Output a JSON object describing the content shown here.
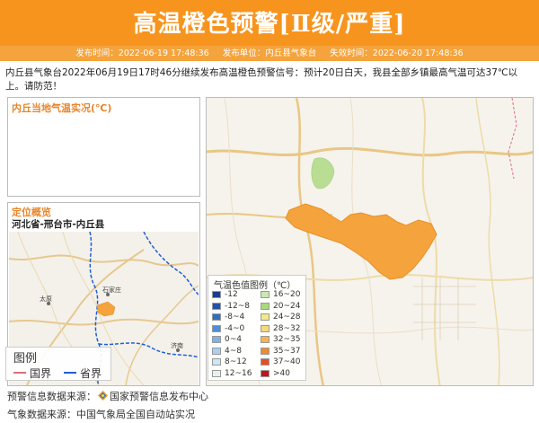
{
  "header": {
    "title": "高温橙色预警[Ⅱ级/严重]"
  },
  "meta": {
    "publish_time": "发布时间：2022-06-19 17:48:36",
    "publisher": "发布单位：内丘县气象台",
    "expire_time": "失效时间：2022-06-20 17:48:36"
  },
  "description": "内丘县气象台2022年06月19日17时46分继续发布高温橙色预警信号：预计20日白天，我县全部乡镇最高气温可达37℃以上。请防范！",
  "temp_panel": {
    "title": "内丘当地气温实况(℃)"
  },
  "location_panel": {
    "title": "定位概览",
    "location": "河北省-邢台市-内丘县",
    "map_labels": {
      "taiyuan": "太原",
      "shijiazhuang": "石家庄",
      "jinan": "济南"
    }
  },
  "map_legend": {
    "title": "图例",
    "national": "国界",
    "provincial": "省界",
    "national_color": "#d9707a",
    "provincial_color": "#1f5fd6"
  },
  "temp_legend": {
    "title": "气温色值图例（℃）",
    "items": [
      {
        "label": "-12",
        "color": "#1b3d8f"
      },
      {
        "label": "-12~8",
        "color": "#2452a8"
      },
      {
        "label": "-8~4",
        "color": "#2f6fc2"
      },
      {
        "label": "-4~0",
        "color": "#4d8fd8"
      },
      {
        "label": "0~4",
        "color": "#7fb3e6"
      },
      {
        "label": "4~8",
        "color": "#a9d0ee"
      },
      {
        "label": "8~12",
        "color": "#cfe6f3"
      },
      {
        "label": "12~16",
        "color": "#e6f3ea"
      },
      {
        "label": "16~20",
        "color": "#c9e8b4"
      },
      {
        "label": "20~24",
        "color": "#a8d97a"
      },
      {
        "label": "24~28",
        "color": "#f0eb8a"
      },
      {
        "label": "28~32",
        "color": "#f7d87b"
      },
      {
        "label": "32~35",
        "color": "#f5b452"
      },
      {
        "label": "35~37",
        "color": "#ee8a33"
      },
      {
        "label": "37~40",
        "color": "#e05024"
      },
      {
        "label": ">40",
        "color": "#c0141c"
      }
    ]
  },
  "footer": {
    "source_warning_label": "预警信息数据来源：",
    "source_warning_value": "国家预警信息发布中心",
    "source_weather": "气象数据来源：中国气象局全国自动站实况"
  },
  "colors": {
    "header_bg": "#f7941d",
    "warning_area": "#f5a33c",
    "accent_text": "#e8862a"
  }
}
